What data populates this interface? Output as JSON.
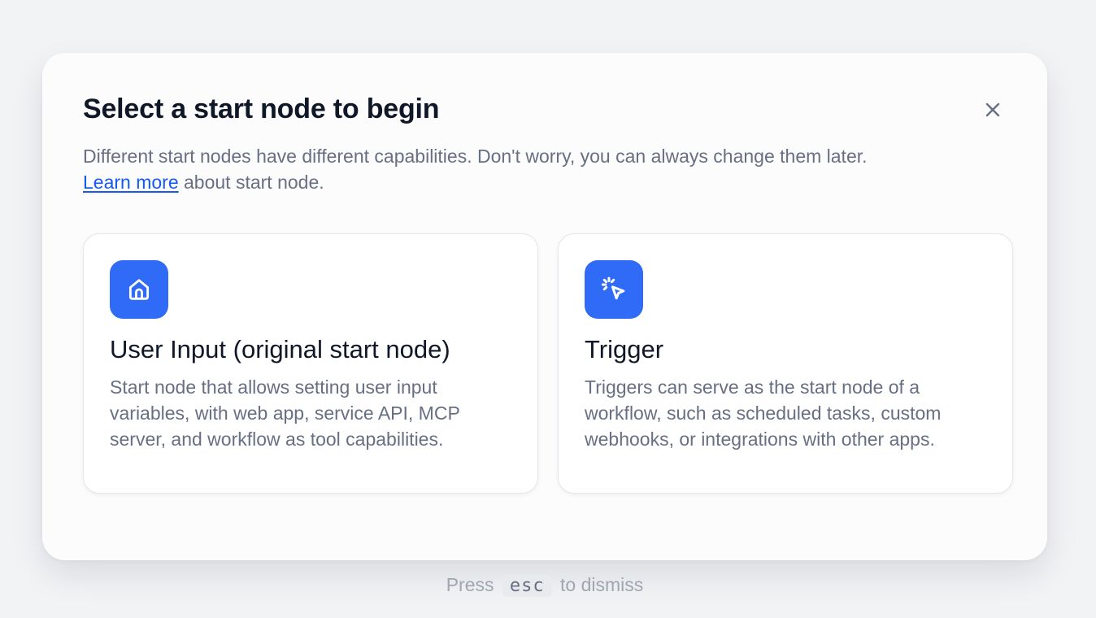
{
  "dialog": {
    "title": "Select a start node to begin",
    "description": "Different start nodes have different capabilities. Don't worry, you can always change them later.",
    "learn_more_link": "Learn more",
    "learn_more_suffix": " about start node."
  },
  "cards": [
    {
      "icon": "home-icon",
      "title": "User Input (original start node)",
      "description": "Start node that allows setting user input variables, with web app, service API, MCP server, and workflow as tool capabilities."
    },
    {
      "icon": "cursor-click-icon",
      "title": "Trigger",
      "description": "Triggers can serve as the start node of a workflow, such as scheduled tasks, custom webhooks, or integrations with other apps."
    }
  ],
  "hint": {
    "prefix": "Press",
    "key": "esc",
    "suffix": "to dismiss"
  },
  "colors": {
    "accent": "#2f6bf6",
    "link": "#155aef",
    "title": "#101828",
    "muted": "#676f83"
  }
}
